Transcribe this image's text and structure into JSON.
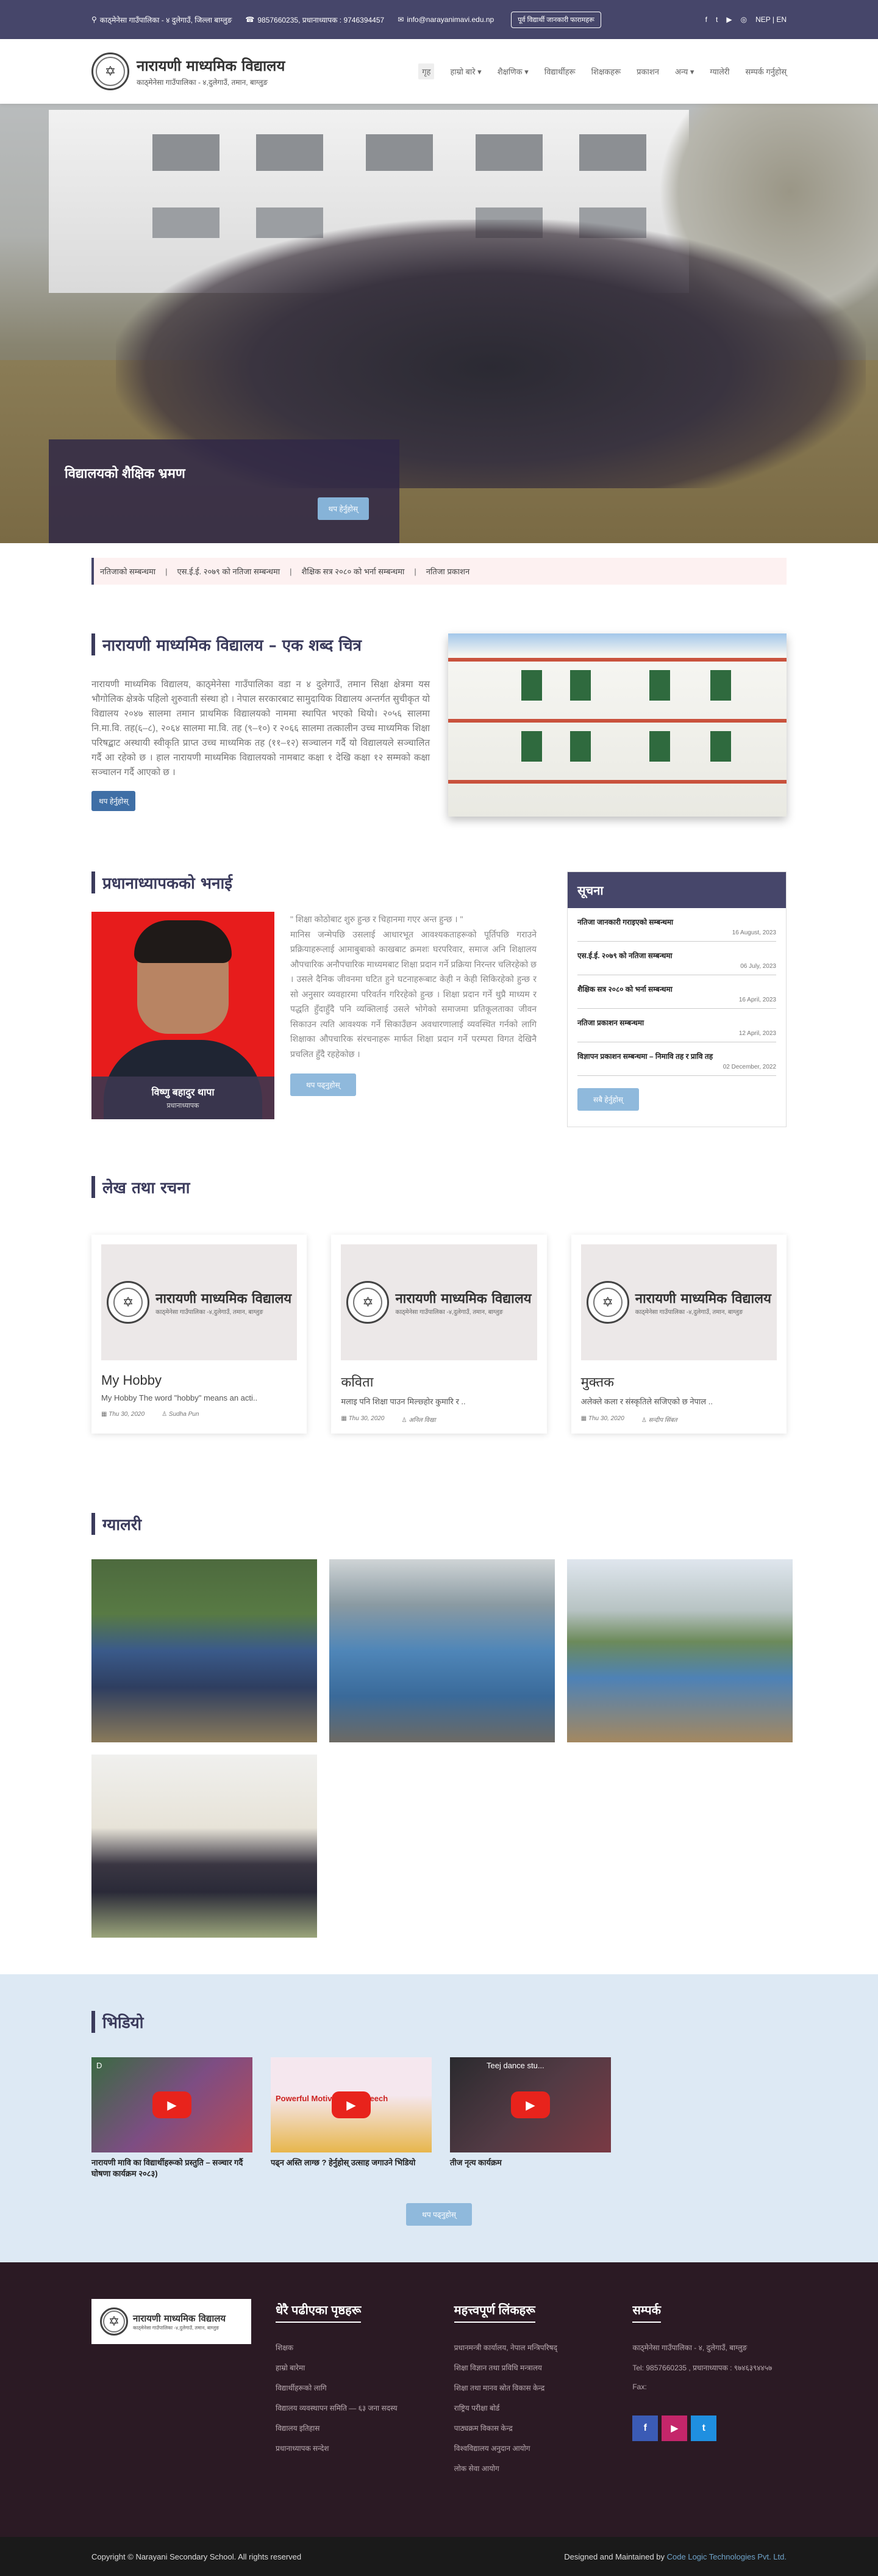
{
  "topbar": {
    "address": "काठ्मेनेसा गाउँपालिका - ४ दुलेगाउँ, जिल्ला बाग्लुङ",
    "phone": "9857660235, प्रधानाध्यापक : 9746394457",
    "email": "info@narayanimavi.edu.np",
    "cta": "पूर्व विद्यार्थी जानकारी फारामहरू",
    "lang": "NEP | EN",
    "social": [
      "f",
      "t",
      "▶",
      "◎"
    ]
  },
  "header": {
    "name": "नारायणी माध्यमिक विद्यालय",
    "sub": "काठ्मेनेसा गाउँपालिका - ४,दुलेगाउँ, तमान, बाग्लुङ",
    "nav": [
      "गृह",
      "हाम्रो बारे ▾",
      "शैक्षणिक ▾",
      "विद्यार्थीहरू",
      "शिक्षकहरू",
      "प्रकाशन",
      "अन्य ▾",
      "ग्यालेरी",
      "सम्पर्क गर्नुहोस्"
    ]
  },
  "hero": {
    "caption": "विद्यालयको शैक्षिक भ्रमण",
    "button": "थप हेर्नुहोस्"
  },
  "ticker": [
    "नतिजाको सम्बन्धमा",
    "एस.ई.ई. २०७९ को नतिजा सम्बन्धमा",
    "शैक्षिक सत्र २०८० को भर्ना सम्बन्धमा",
    "नतिजा प्रकाशन"
  ],
  "about": {
    "title": "नारायणी माध्यमिक विद्यालय – एक शब्द चित्र",
    "text": "नारायणी माध्यमिक विद्यालय, काठ्मेनेसा गाउँपालिका वडा न ४ दुलेगाउँ, तमान सिक्षा क्षेत्रमा यस भौगोलिक क्षेत्रके पहिलो शुरुवाती संस्था हो । नेपाल सरकारबाट सामुदायिक विद्यालय अन्तर्गत सुचीकृत यो विद्यालय २०४७ सालमा तमान प्राथमिक विद्यालयको नाममा स्थापित भएको थियो। २०५६ सालमा नि.मा.वि. तह(६–८), २०६४ सालमा मा.वि. तह (९–१०) र २०६६ सालमा तत्कालीन उच्च माध्यमिक शिक्षा परिषद्बाट अस्थायी स्वीकृति प्राप्त उच्च माध्यमिक तह (११–१२) सञ्चालन गर्दै यो विद्यालयले सञ्चालित गर्दै आ रहेको छ । हाल नारायणी माध्यमिक विद्यालयको नामबाट कक्षा १ देखि कक्षा १२ सम्मको कक्षा सञ्चालन गर्दै आएको छ ।",
    "button": "थप हेर्नुहोस्"
  },
  "principal": {
    "title": "प्रधानाध्यापकको भनाई",
    "name": "विष्णु बहादुर थापा",
    "role": "प्रधानाध्यापक",
    "quote": "\" शिक्षा कोठोबाट शुरु हुन्छ र चिहानमा गएर अन्त हुन्छ । \"\nमानिस जन्मेपछि उसलाई आधारभूत आवश्यकताहरूको पूर्तिपछि गराउने प्रक्रियाहरूलाई आमाबुबाको काखबाट क्रमशः घरपरिवार, समाज अनि शिक्षालय औपचारिक अनौपचारिक माध्यमबाट शिक्षा प्रदान गर्ने प्रक्रिया निरन्तर चलिरहेको छ । उसले दैनिक जीवनमा घटित हुने घटनाहरूबाट केही न केही सिकिरहेको हुन्छ र सो अनुसार व्यवहारमा परिवर्तन गरिरहेको हुन्छ । शिक्षा प्रदान गर्ने थुप्रै माध्यम र पद्धति हुँदाहुँदै पनि व्यक्तिलाई उसले भोगेको समाजमा प्रतिकूलताका जीवन सिकाउन त्यति आवश्यक गर्ने सिकाउँछन अवधारणालाई व्यवस्थित गर्नको लागि शिक्षाका औपचारिक संरचनाहरू मार्फत शिक्षा प्रदान गर्ने परम्परा विगत देखिनै प्रचलित हुँदै रहहेकोछ ।",
    "button": "थप पढ्नुहोस्"
  },
  "notices": {
    "title": "सूचना",
    "items": [
      {
        "t": "नतिजा जानकारी गराइएको सम्बन्धमा",
        "d": "16 August, 2023"
      },
      {
        "t": "एस.ई.ई. २०७९ को नतिजा सम्बन्धमा",
        "d": "06 July, 2023"
      },
      {
        "t": "शैक्षिक सत्र २०८० को भर्ना सम्बन्धमा",
        "d": "16 April, 2023"
      },
      {
        "t": "नतिजा प्रकाशन सम्बन्धमा",
        "d": "12 April, 2023"
      },
      {
        "t": "विज्ञापन प्रकाशन सम्बन्धमा – निमावि तह र प्रावि तह",
        "d": "02 December, 2022"
      }
    ],
    "button": "सबै हेर्नुहोस्"
  },
  "articles": {
    "title": "लेख तथा रचना",
    "banner_title": "नारायणी माध्यमिक विद्यालय",
    "banner_sub": "काठ्मेनेसा गाउँपालिका -४,दुलेगाउँ, तमान, बाग्लुङ",
    "items": [
      {
        "title": "My Hobby",
        "excerpt": "My Hobby The word \"hobby\" means an acti..",
        "date": "Thu 30, 2020",
        "author": "Sudha Pun"
      },
      {
        "title": "कविता",
        "excerpt": "मलाइ पनि शिक्षा पाउन मिल्छ्होर कुमारि र ..",
        "date": "Thu 30, 2020",
        "author": "अनिल विखा"
      },
      {
        "title": "मुक्तक",
        "excerpt": "अलेक्ले कला र संस्कृतिले सजिएको छ नेपाल ..",
        "date": "Thu 30, 2020",
        "author": "सन्दीप सिंबत"
      }
    ]
  },
  "gallery": {
    "title": "ग्यालरी"
  },
  "videos": {
    "title": "भिडियो",
    "items": [
      {
        "overlay": "D",
        "caption": "नारायणी मावि का विद्यार्थीहरूको प्रस्तुति – सञ्चार गर्दै घोषणा कार्यक्रम २०८३)"
      },
      {
        "overlay": "Powerful Motivational Speech",
        "caption": "पढ्न अस्ति लाग्छ ? हेर्नुहोस् उत्साह जगाउने भिडियो"
      },
      {
        "overlay": "Teej dance stu...",
        "caption": "तीज नृत्य कार्यक्रम"
      }
    ],
    "button": "थप पढ्नुहोस्"
  },
  "footer": {
    "brand_title": "नारायणी माध्यमिक विद्यालय",
    "brand_sub": "काठ्मेनेसा गाउँपालिका -४,दुलेगाउँ, तमान, बाग्लुङ",
    "col2_title": "धेरै पढीएका पृष्ठहरू",
    "col2": [
      "शिक्षक",
      "हाम्रो बारेमा",
      "विद्यार्थीहरूको लागि",
      "विद्यालय व्यवस्थापन समिति — ६३ जना सदस्य",
      "विद्यालय इतिहास",
      "प्रधानाध्यापक सन्देश"
    ],
    "col3_title": "महत्त्वपूर्ण लिंकहरू",
    "col3": [
      "प्रधानमन्त्री कार्यालय, नेपाल मन्त्रिपरिषद्",
      "शिक्षा विज्ञान तथा प्रविधि मन्त्रालय",
      "शिक्षा तथा मानव स्रोत विकास केन्द्र",
      "राष्ट्रिय परीक्षा बोर्ड",
      "पाठ्यक्रम विकास केन्द्र",
      "विश्वविद्यालय अनुदान आयोग",
      "लोक सेवा आयोग"
    ],
    "col4_title": "सम्पर्क",
    "contact_addr": "काठ्मेनेसा गाउँपालिका - ४, दुलेगाउँ, बाग्लुङ",
    "contact_tel": "Tel: 9857660235 , प्रधानाध्यापक : ९७४६३९४४५७",
    "contact_fax": "Fax:",
    "social": [
      "f",
      "▶",
      "t"
    ]
  },
  "bottom": {
    "copyright": "Copyright © Narayani Secondary School. All rights reserved",
    "credit": "Designed and Maintained by",
    "credit_link": "Code Logic Technologies Pvt. Ltd."
  }
}
